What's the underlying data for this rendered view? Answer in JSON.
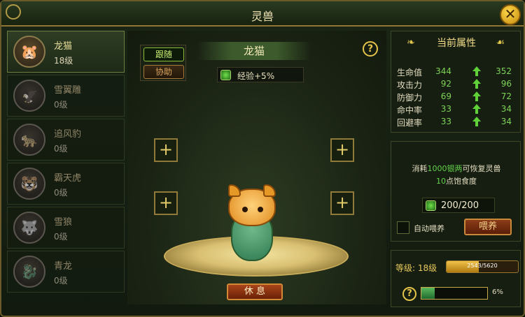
{
  "window": {
    "title": "灵兽",
    "close_label": "✕"
  },
  "pets": [
    {
      "name": "龙猫",
      "level": "18级",
      "icon": "hamster-icon",
      "active": true
    },
    {
      "name": "雪翼雕",
      "level": "0级",
      "icon": "eagle-icon",
      "active": false
    },
    {
      "name": "追风豹",
      "level": "0级",
      "icon": "leopard-icon",
      "active": false
    },
    {
      "name": "霸天虎",
      "level": "0级",
      "icon": "tiger-icon",
      "active": false
    },
    {
      "name": "雪狼",
      "level": "0级",
      "icon": "wolf-icon",
      "active": false
    },
    {
      "name": "青龙",
      "level": "0级",
      "icon": "dragon-icon",
      "active": false
    }
  ],
  "center": {
    "mode_follow": "跟随",
    "mode_assist": "协助",
    "pet_name": "龙猫",
    "bonus": "经验+5%",
    "help": "?",
    "slot_symbol": "+",
    "rest_label": "休 息"
  },
  "attributes": {
    "title": "当前属性",
    "rows": [
      {
        "label": "生命值",
        "current": "344",
        "next": "352"
      },
      {
        "label": "攻击力",
        "current": "92",
        "next": "96"
      },
      {
        "label": "防御力",
        "current": "69",
        "next": "72"
      },
      {
        "label": "命中率",
        "current": "33",
        "next": "34"
      },
      {
        "label": "回避率",
        "current": "33",
        "next": "34"
      }
    ]
  },
  "feed": {
    "text_prefix": "消耗",
    "text_amount": "1000银两",
    "text_mid": "可恢复灵兽",
    "text_restore_num": "10",
    "text_suffix": "点饱食度",
    "satiety": "200/200",
    "auto_feed_label": "自动喂养",
    "feed_button": "喂养"
  },
  "level": {
    "label": "等级: 18级",
    "exp_text": "2543/5620",
    "exp_fraction": 0.45,
    "progress_fraction": 0.06,
    "progress_text": "6%",
    "help": "?"
  },
  "colors": {
    "accent_gold": "#e4c44a",
    "stat_green": "#7ed357",
    "bg_dark": "#161e11"
  }
}
